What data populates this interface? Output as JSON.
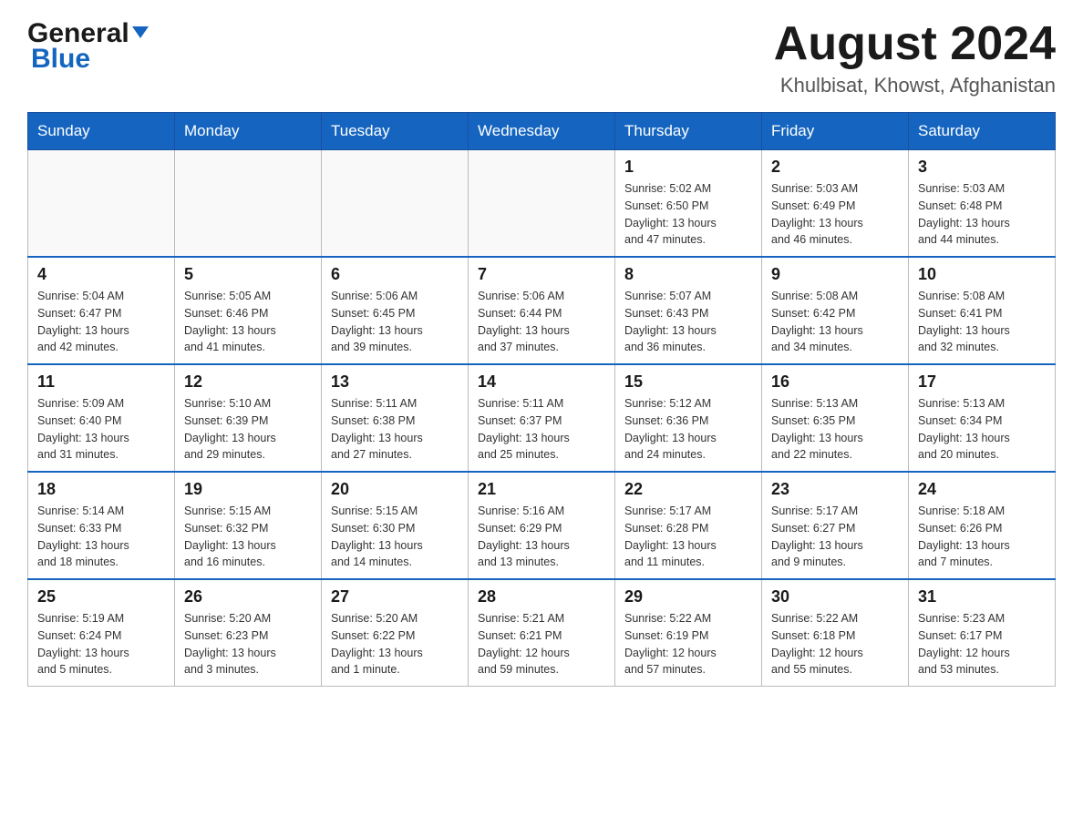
{
  "header": {
    "logo_general": "General",
    "logo_blue": "Blue",
    "title": "August 2024",
    "subtitle": "Khulbisat, Khowst, Afghanistan"
  },
  "days_of_week": [
    "Sunday",
    "Monday",
    "Tuesday",
    "Wednesday",
    "Thursday",
    "Friday",
    "Saturday"
  ],
  "weeks": [
    {
      "cells": [
        {
          "day": "",
          "info": ""
        },
        {
          "day": "",
          "info": ""
        },
        {
          "day": "",
          "info": ""
        },
        {
          "day": "",
          "info": ""
        },
        {
          "day": "1",
          "info": "Sunrise: 5:02 AM\nSunset: 6:50 PM\nDaylight: 13 hours\nand 47 minutes."
        },
        {
          "day": "2",
          "info": "Sunrise: 5:03 AM\nSunset: 6:49 PM\nDaylight: 13 hours\nand 46 minutes."
        },
        {
          "day": "3",
          "info": "Sunrise: 5:03 AM\nSunset: 6:48 PM\nDaylight: 13 hours\nand 44 minutes."
        }
      ]
    },
    {
      "cells": [
        {
          "day": "4",
          "info": "Sunrise: 5:04 AM\nSunset: 6:47 PM\nDaylight: 13 hours\nand 42 minutes."
        },
        {
          "day": "5",
          "info": "Sunrise: 5:05 AM\nSunset: 6:46 PM\nDaylight: 13 hours\nand 41 minutes."
        },
        {
          "day": "6",
          "info": "Sunrise: 5:06 AM\nSunset: 6:45 PM\nDaylight: 13 hours\nand 39 minutes."
        },
        {
          "day": "7",
          "info": "Sunrise: 5:06 AM\nSunset: 6:44 PM\nDaylight: 13 hours\nand 37 minutes."
        },
        {
          "day": "8",
          "info": "Sunrise: 5:07 AM\nSunset: 6:43 PM\nDaylight: 13 hours\nand 36 minutes."
        },
        {
          "day": "9",
          "info": "Sunrise: 5:08 AM\nSunset: 6:42 PM\nDaylight: 13 hours\nand 34 minutes."
        },
        {
          "day": "10",
          "info": "Sunrise: 5:08 AM\nSunset: 6:41 PM\nDaylight: 13 hours\nand 32 minutes."
        }
      ]
    },
    {
      "cells": [
        {
          "day": "11",
          "info": "Sunrise: 5:09 AM\nSunset: 6:40 PM\nDaylight: 13 hours\nand 31 minutes."
        },
        {
          "day": "12",
          "info": "Sunrise: 5:10 AM\nSunset: 6:39 PM\nDaylight: 13 hours\nand 29 minutes."
        },
        {
          "day": "13",
          "info": "Sunrise: 5:11 AM\nSunset: 6:38 PM\nDaylight: 13 hours\nand 27 minutes."
        },
        {
          "day": "14",
          "info": "Sunrise: 5:11 AM\nSunset: 6:37 PM\nDaylight: 13 hours\nand 25 minutes."
        },
        {
          "day": "15",
          "info": "Sunrise: 5:12 AM\nSunset: 6:36 PM\nDaylight: 13 hours\nand 24 minutes."
        },
        {
          "day": "16",
          "info": "Sunrise: 5:13 AM\nSunset: 6:35 PM\nDaylight: 13 hours\nand 22 minutes."
        },
        {
          "day": "17",
          "info": "Sunrise: 5:13 AM\nSunset: 6:34 PM\nDaylight: 13 hours\nand 20 minutes."
        }
      ]
    },
    {
      "cells": [
        {
          "day": "18",
          "info": "Sunrise: 5:14 AM\nSunset: 6:33 PM\nDaylight: 13 hours\nand 18 minutes."
        },
        {
          "day": "19",
          "info": "Sunrise: 5:15 AM\nSunset: 6:32 PM\nDaylight: 13 hours\nand 16 minutes."
        },
        {
          "day": "20",
          "info": "Sunrise: 5:15 AM\nSunset: 6:30 PM\nDaylight: 13 hours\nand 14 minutes."
        },
        {
          "day": "21",
          "info": "Sunrise: 5:16 AM\nSunset: 6:29 PM\nDaylight: 13 hours\nand 13 minutes."
        },
        {
          "day": "22",
          "info": "Sunrise: 5:17 AM\nSunset: 6:28 PM\nDaylight: 13 hours\nand 11 minutes."
        },
        {
          "day": "23",
          "info": "Sunrise: 5:17 AM\nSunset: 6:27 PM\nDaylight: 13 hours\nand 9 minutes."
        },
        {
          "day": "24",
          "info": "Sunrise: 5:18 AM\nSunset: 6:26 PM\nDaylight: 13 hours\nand 7 minutes."
        }
      ]
    },
    {
      "cells": [
        {
          "day": "25",
          "info": "Sunrise: 5:19 AM\nSunset: 6:24 PM\nDaylight: 13 hours\nand 5 minutes."
        },
        {
          "day": "26",
          "info": "Sunrise: 5:20 AM\nSunset: 6:23 PM\nDaylight: 13 hours\nand 3 minutes."
        },
        {
          "day": "27",
          "info": "Sunrise: 5:20 AM\nSunset: 6:22 PM\nDaylight: 13 hours\nand 1 minute."
        },
        {
          "day": "28",
          "info": "Sunrise: 5:21 AM\nSunset: 6:21 PM\nDaylight: 12 hours\nand 59 minutes."
        },
        {
          "day": "29",
          "info": "Sunrise: 5:22 AM\nSunset: 6:19 PM\nDaylight: 12 hours\nand 57 minutes."
        },
        {
          "day": "30",
          "info": "Sunrise: 5:22 AM\nSunset: 6:18 PM\nDaylight: 12 hours\nand 55 minutes."
        },
        {
          "day": "31",
          "info": "Sunrise: 5:23 AM\nSunset: 6:17 PM\nDaylight: 12 hours\nand 53 minutes."
        }
      ]
    }
  ]
}
